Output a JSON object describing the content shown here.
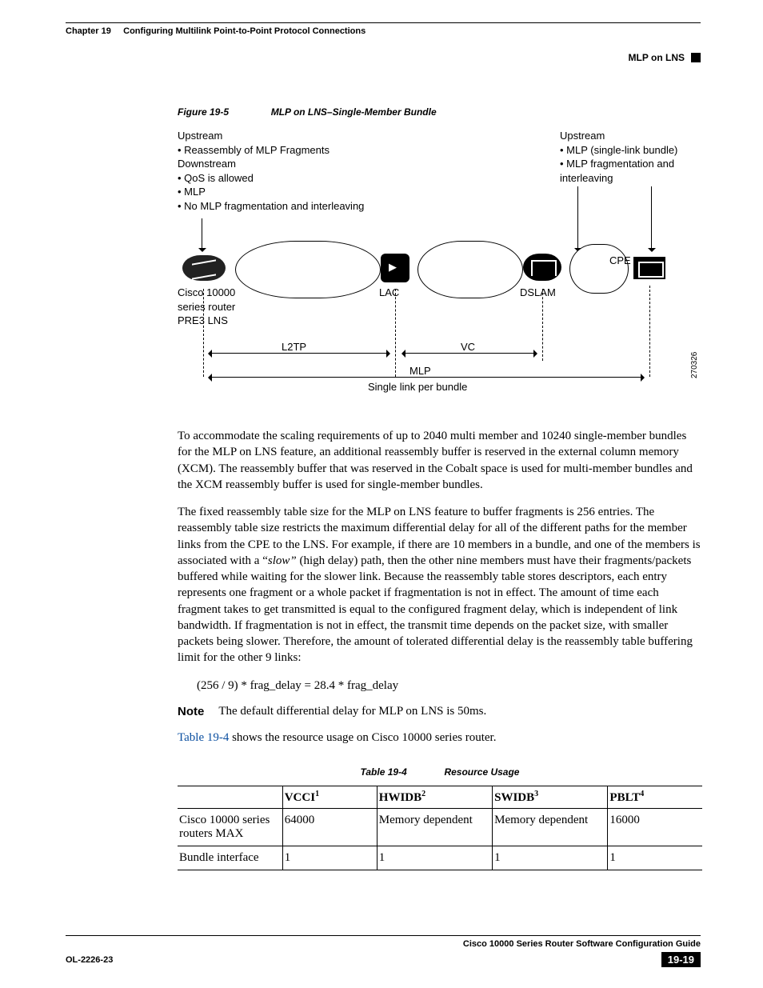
{
  "header": {
    "chapter": "Chapter 19",
    "chapter_title": "Configuring Multilink Point-to-Point Protocol Connections",
    "section_right": "MLP on LNS"
  },
  "figure": {
    "label": "Figure 19-5",
    "title": "MLP on LNS–Single-Member Bundle",
    "left": {
      "up_hdr": "Upstream",
      "up_items": [
        "Reassembly of MLP Fragments"
      ],
      "down_hdr": "Downstream",
      "down_items": [
        "QoS is allowed",
        "MLP",
        "No MLP fragmentation and interleaving"
      ]
    },
    "right": {
      "up_hdr": "Upstream",
      "up_items": [
        "MLP (single-link bundle)",
        "MLP fragmentation and interleaving"
      ]
    },
    "labels": {
      "router": "Cisco 10000 series router PRE3 LNS",
      "lac": "LAC",
      "dslam": "DSLAM",
      "cpe": "CPE",
      "l2tp": "L2TP",
      "vc": "VC",
      "mlp": "MLP",
      "slpb": "Single link per bundle",
      "refnum": "270326"
    }
  },
  "body": {
    "p1": "To accommodate the scaling requirements of up to 2040 multi member and 10240 single-member bundles for the MLP on LNS feature, an additional reassembly buffer is reserved in the external column memory (XCM). The reassembly buffer that was reserved in the Cobalt space is used for multi-member bundles and the XCM reassembly buffer is used for single-member bundles.",
    "p2a": "The fixed reassembly table size for the MLP on LNS feature to buffer fragments is 256 entries. The reassembly table size restricts the maximum differential delay for all of the different paths for the member links from the CPE to the LNS. For example, if there are 10 members in a bundle, and one of the members is associated with a “",
    "p2_slow": "slow”",
    "p2b": " (high delay) path, then the other nine members must have their fragments/packets buffered while waiting for the slower link. Because the reassembly table stores descriptors, each entry represents one fragment or a whole packet if fragmentation is not in effect. The amount of time each fragment takes to get transmitted is equal to the configured fragment delay, which is independent of link bandwidth. If fragmentation is not in effect, the transmit time depends on the packet size, with smaller packets being slower. Therefore, the amount of tolerated differential delay is the reassembly table buffering limit for the other 9 links:",
    "formula": "(256 / 9) * frag_delay = 28.4 * frag_delay",
    "note_label": "Note",
    "note_text": "The default differential delay for MLP on LNS is 50ms.",
    "p3_link": "Table 19-4",
    "p3_rest": " shows the resource usage on Cisco 10000 series router."
  },
  "table": {
    "label": "Table 19-4",
    "title": "Resource Usage",
    "headers": {
      "c0": "",
      "c1": "VCCI",
      "c2": "HWIDB",
      "c3": "SWIDB",
      "c4": "PBLT",
      "s1": "1",
      "s2": "2",
      "s3": "3",
      "s4": "4"
    },
    "rows": [
      {
        "c0": "Cisco 10000 series routers MAX",
        "c1": "64000",
        "c2": "Memory dependent",
        "c3": "Memory dependent",
        "c4": "16000"
      },
      {
        "c0": "Bundle interface",
        "c1": "1",
        "c2": "1",
        "c3": "1",
        "c4": "1"
      }
    ]
  },
  "footer": {
    "guide": "Cisco 10000 Series Router Software Configuration Guide",
    "docnum": "OL-2226-23",
    "page": "19-19"
  }
}
